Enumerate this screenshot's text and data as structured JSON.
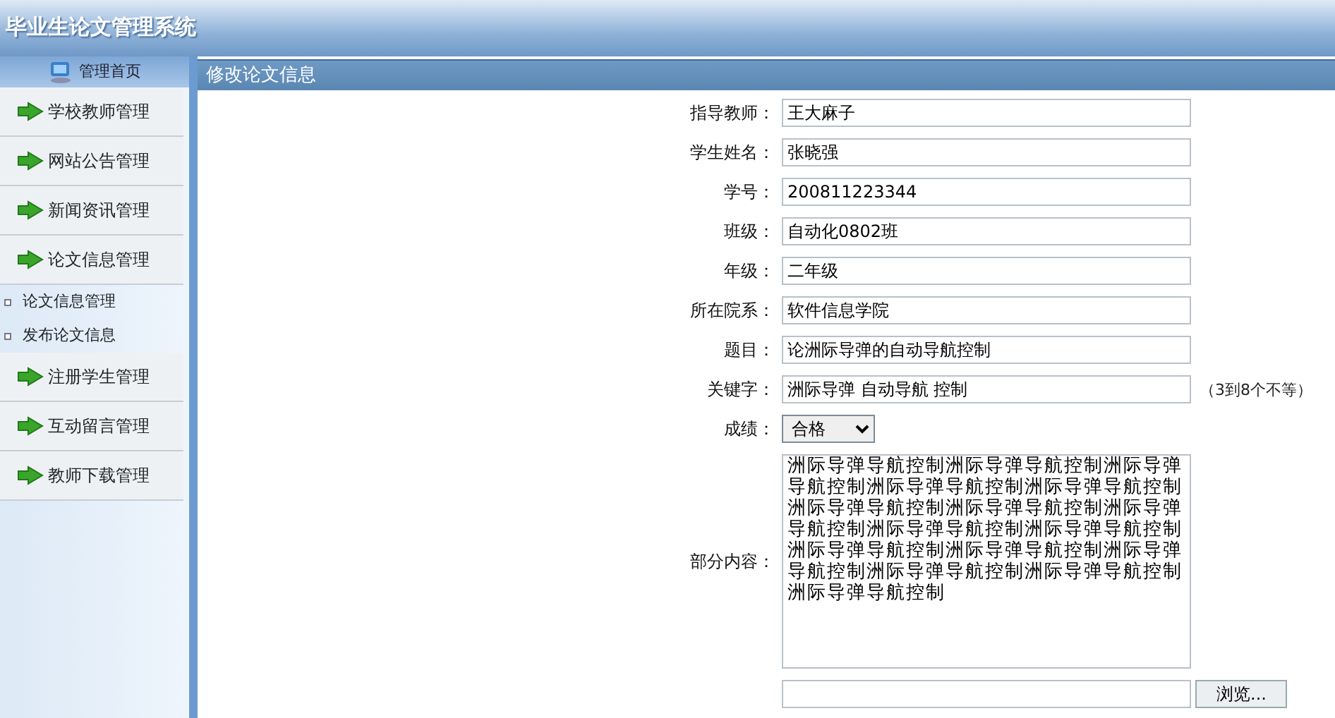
{
  "header": {
    "title": "毕业生论文管理系统"
  },
  "sidebar": {
    "home": "管理首页",
    "items": [
      {
        "label": "学校教师管理"
      },
      {
        "label": "网站公告管理"
      },
      {
        "label": "新闻资讯管理"
      },
      {
        "label": "论文信息管理",
        "children": [
          {
            "label": "论文信息管理"
          },
          {
            "label": "发布论文信息"
          }
        ]
      },
      {
        "label": "注册学生管理"
      },
      {
        "label": "互动留言管理"
      },
      {
        "label": "教师下载管理"
      }
    ]
  },
  "panel": {
    "title": "修改论文信息",
    "fields": [
      {
        "kind": "text",
        "label": "指导教师：",
        "value": "王大麻子"
      },
      {
        "kind": "text",
        "label": "学生姓名：",
        "value": "张晓强"
      },
      {
        "kind": "text",
        "label": "学号：",
        "value": "200811223344"
      },
      {
        "kind": "text",
        "label": "班级：",
        "value": "自动化0802班"
      },
      {
        "kind": "text",
        "label": "年级：",
        "value": "二年级"
      },
      {
        "kind": "text",
        "label": "所在院系：",
        "value": "软件信息学院"
      },
      {
        "kind": "text",
        "label": "题目：",
        "value": "论洲际导弹的自动导航控制"
      },
      {
        "kind": "text",
        "label": "关键字：",
        "value": "洲际导弹 自动导航 控制",
        "hint": "（3到8个不等）"
      },
      {
        "kind": "select",
        "label": "成绩：",
        "value": "合格"
      },
      {
        "kind": "textarea",
        "label": "部分内容：",
        "value": "洲际导弹导航控制洲际导弹导航控制洲际导弹导航控制洲际导弹导航控制洲际导弹导航控制洲际导弹导航控制洲际导弹导航控制洲际导弹导航控制洲际导弹导航控制洲际导弹导航控制洲际导弹导航控制洲际导弹导航控制洲际导弹导航控制洲际导弹导航控制洲际导弹导航控制洲际导弹导航控制"
      },
      {
        "kind": "file",
        "button": "浏览..."
      }
    ]
  }
}
